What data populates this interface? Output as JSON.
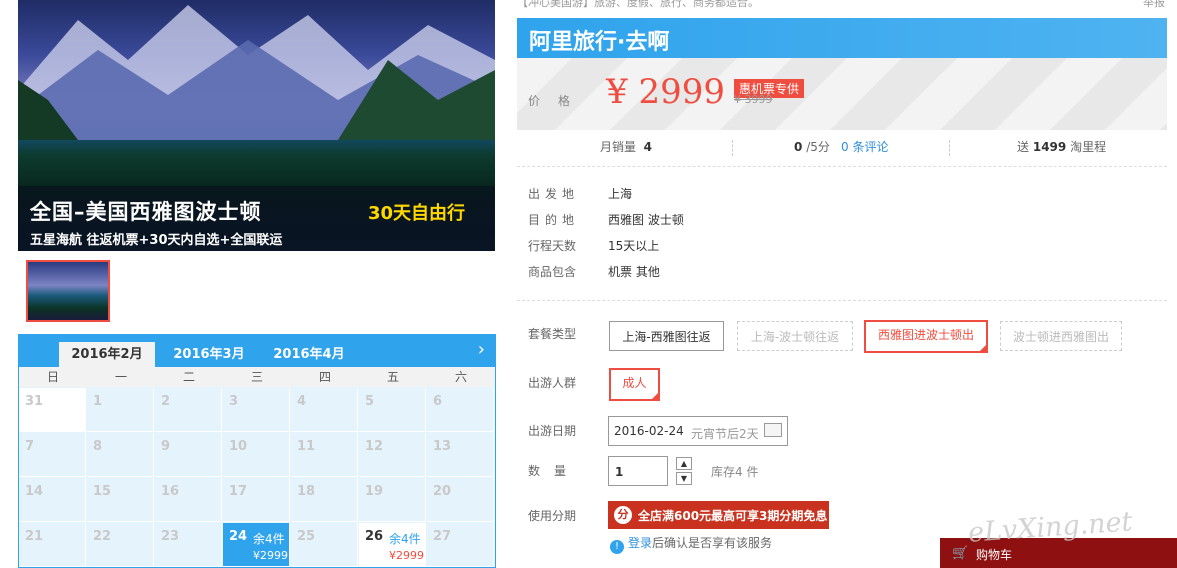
{
  "hero": {
    "title": "全国–美国西雅图波士顿",
    "title_highlight": "30天自由行",
    "subtitle": "五星海航  往返机票+30天内自选+全国联运"
  },
  "calendar": {
    "months": [
      "2016年2月",
      "2016年3月",
      "2016年4月"
    ],
    "next_icon": "›",
    "weekdays": [
      "日",
      "一",
      "二",
      "三",
      "四",
      "五",
      "六"
    ],
    "rows": [
      [
        "31",
        "1",
        "2",
        "3",
        "4",
        "5",
        "6"
      ],
      [
        "7",
        "8",
        "9",
        "10",
        "11",
        "12",
        "13"
      ],
      [
        "14",
        "15",
        "16",
        "17",
        "18",
        "19",
        "20"
      ],
      [
        "21",
        "22",
        "23",
        "24",
        "25",
        "26",
        "27"
      ]
    ],
    "day24": {
      "day": "24",
      "stock": "余4件",
      "price": "¥2999"
    },
    "day26": {
      "day": "26",
      "stock": "余4件",
      "price": "¥2999"
    }
  },
  "top": {
    "partial_left": "【冲心美国游】旅游、度假、旅行、商务都适合。",
    "partial_right": "举报"
  },
  "brand": {
    "name": "阿里旅行·去啊"
  },
  "price": {
    "label": "价格",
    "value": "¥ 2999",
    "badge": "惠机票专供",
    "original": "¥ 3999"
  },
  "stats": {
    "sales_label": "月销量",
    "sales_value": "4",
    "rating_value": "0",
    "rating_max": "/5分",
    "reviews": "0 条评论",
    "mileage_label": "送",
    "mileage_value": "1499",
    "mileage_unit": "淘里程"
  },
  "info": {
    "departure_label": "出发地",
    "departure": "上海",
    "destination_label": "目的地",
    "destination": "西雅图   波士顿",
    "days_label": "行程天数",
    "days": "15天以上",
    "includes_label": "商品包含",
    "includes": "机票   其他"
  },
  "options": {
    "package_label": "套餐类型",
    "packages": [
      "上海-西雅图往返",
      "上海-波士顿往返",
      "西雅图进波士顿出",
      "波士顿进西雅图出"
    ],
    "traveler_label": "出游人群",
    "traveler": "成人",
    "date_label": "出游日期",
    "date_value": "2016-02-24",
    "date_note": "元宵节后2天",
    "qty_label": "数量",
    "qty_value": "1",
    "stock": "库存4 件",
    "installment_label": "使用分期",
    "installment_promo": "全店满600元最高可享3期分期免息",
    "login_link": "登录",
    "login_text": "后确认是否享有该服务"
  },
  "cart": {
    "label": "购物车"
  },
  "watermark": "eLvXing.net",
  "colors": {
    "accent_blue": "#2fa3ec",
    "accent_red": "#ef4d3f",
    "promo_red": "#c8321f"
  }
}
